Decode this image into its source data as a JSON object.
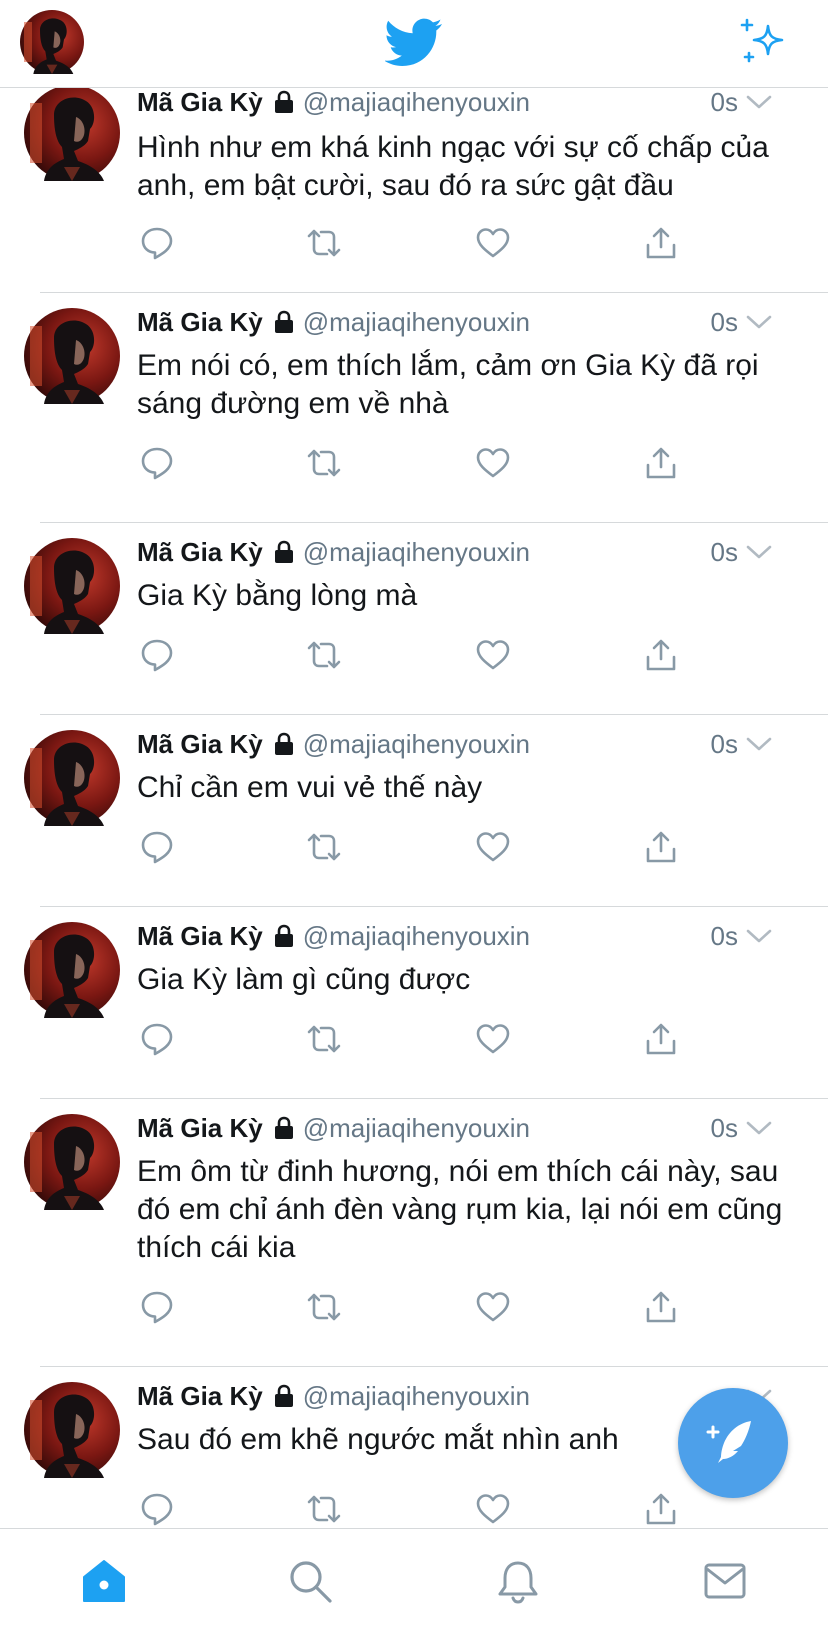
{
  "header": {
    "logo_icon": "twitter-bird-icon",
    "sparkle_icon": "sparkle-icon",
    "brand_color": "#1da1f2"
  },
  "timeline": {
    "tweets": [
      {
        "name": "Mã Gia Kỳ",
        "handle": "@majiaqihenyouxin",
        "time": "0s",
        "text": "Hình như em khá kinh ngạc với sự cố chấp của anh, em bật cười, sau đó ra sức gật đầu"
      },
      {
        "name": "Mã Gia Kỳ",
        "handle": "@majiaqihenyouxin",
        "time": "0s",
        "text": "Em nói có, em thích lắm, cảm ơn Gia Kỳ đã rọi sáng đường em về nhà"
      },
      {
        "name": "Mã Gia Kỳ",
        "handle": "@majiaqihenyouxin",
        "time": "0s",
        "text": "Gia Kỳ bằng lòng mà"
      },
      {
        "name": "Mã Gia Kỳ",
        "handle": "@majiaqihenyouxin",
        "time": "0s",
        "text": "Chỉ cần em vui vẻ thế này"
      },
      {
        "name": "Mã Gia Kỳ",
        "handle": "@majiaqihenyouxin",
        "time": "0s",
        "text": "Gia Kỳ làm gì cũng được"
      },
      {
        "name": "Mã Gia Kỳ",
        "handle": "@majiaqihenyouxin",
        "time": "0s",
        "text": "Em ôm từ đinh hương, nói em thích cái này, sau đó em chỉ ánh đèn vàng rụm kia, lại nói em cũng thích cái kia"
      },
      {
        "name": "Mã Gia Kỳ",
        "handle": "@majiaqihenyouxin",
        "time": "",
        "text": "Sau đó em khẽ ngước mắt nhìn anh"
      }
    ],
    "action_icons": [
      "reply-icon",
      "retweet-icon",
      "like-icon",
      "share-icon"
    ]
  },
  "compose": {
    "icon": "compose-tweet-icon",
    "color": "#4da0ea"
  },
  "tabbar": {
    "tabs": [
      {
        "icon": "home-icon",
        "active": true
      },
      {
        "icon": "search-icon",
        "active": false
      },
      {
        "icon": "notifications-bell-icon",
        "active": false
      },
      {
        "icon": "messages-envelope-icon",
        "active": false
      }
    ],
    "active_color": "#1da1f2",
    "inactive_color": "#8899a6"
  }
}
